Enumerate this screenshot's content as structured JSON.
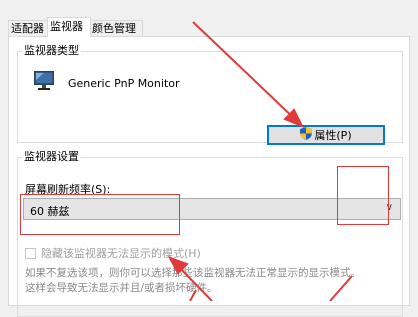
{
  "tabs": [
    {
      "label": "适配器",
      "active": false
    },
    {
      "label": "监视器",
      "active": true
    },
    {
      "label": "颜色管理",
      "active": false
    }
  ],
  "monitor_type": {
    "title": "监视器类型",
    "name": "Generic PnP Monitor",
    "properties_button": "属性(P)"
  },
  "monitor_settings": {
    "title": "监视器设置",
    "refresh_label": "屏幕刷新频率(S):",
    "refresh_value": "60 赫兹",
    "hide_modes_label": "隐藏该监视器无法显示的模式(H)",
    "hide_modes_checked": false,
    "description_line1": "如果不复选该项，则你可以选择那些该监视器无法正常显示的显示模式。",
    "description_line2": "这样会导致无法显示并且/或者损坏硬件。"
  },
  "colors": {
    "annotation_red": "#e03a3a",
    "accent_blue": "#0078d7"
  }
}
